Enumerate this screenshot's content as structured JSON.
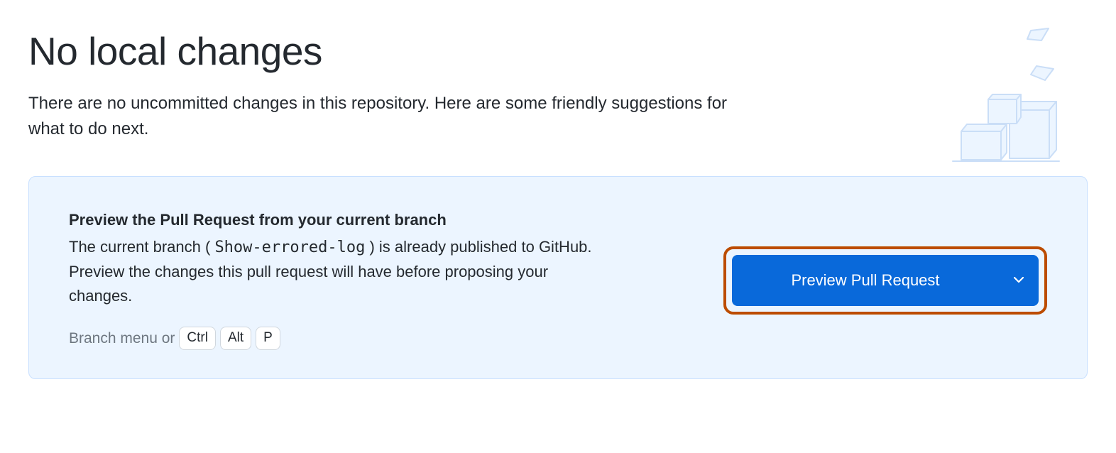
{
  "header": {
    "title": "No local changes",
    "subtitle": "There are no uncommitted changes in this repository. Here are some friendly suggestions for what to do next."
  },
  "suggestion": {
    "title": "Preview the Pull Request from your current branch",
    "desc_prefix": "The current branch ( ",
    "branch_name": "Show-errored-log",
    "desc_suffix": " ) is already published to GitHub. Preview the changes this pull request will have before proposing your changes.",
    "shortcut_prefix": "Branch menu or",
    "keys": [
      "Ctrl",
      "Alt",
      "P"
    ],
    "button_label": "Preview Pull Request"
  },
  "colors": {
    "accent": "#0969da",
    "highlight_border": "#bc4c00",
    "card_bg": "#ecf5ff",
    "illustration": "#cadef7"
  }
}
